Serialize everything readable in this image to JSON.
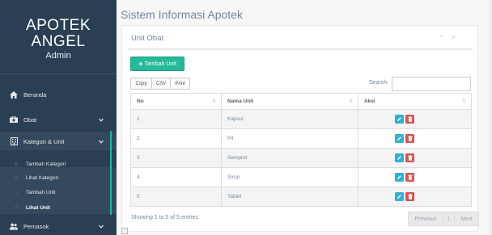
{
  "app": {
    "brand_line1": "APOTEK",
    "brand_line2": "ANGEL",
    "brand_sub": "Admin"
  },
  "sidebar": {
    "items": [
      {
        "label": "Beranda",
        "icon": "home-icon"
      },
      {
        "label": "Obat",
        "icon": "medkit-icon",
        "has_chevron": true
      },
      {
        "label": "Kategori & Unit",
        "icon": "building-icon",
        "has_chevron": true,
        "expanded": true
      },
      {
        "label": "Pemasok",
        "icon": "users-icon",
        "has_chevron": true
      }
    ],
    "sub_items": [
      {
        "label": "Tambah Kategori"
      },
      {
        "label": "Lihat Kategori"
      },
      {
        "label": "Tambah Unit"
      },
      {
        "label": "Lihat Unit",
        "current": true
      }
    ]
  },
  "page": {
    "title": "Sistem Informasi Apotek"
  },
  "panel": {
    "title": "Unit Obat",
    "tools": "^ ×",
    "add_button": "Tambah Unit",
    "export_buttons": [
      "Copy",
      "CSV",
      "Print"
    ],
    "search_label": "Search:",
    "search_value": ""
  },
  "table": {
    "headers": [
      "No",
      "Nama Unit",
      "Aksi"
    ],
    "rows": [
      {
        "no": "1",
        "name": "Kapsul"
      },
      {
        "no": "2",
        "name": "Pil"
      },
      {
        "no": "3",
        "name": "Semprot"
      },
      {
        "no": "4",
        "name": "Sirup"
      },
      {
        "no": "5",
        "name": "Tablet"
      }
    ]
  },
  "footer": {
    "info": "Showing 1 to 5 of 5 entries",
    "previous": "Previous",
    "page": "1",
    "next": "Next"
  },
  "colors": {
    "sidebar_bg": "#2a3f54",
    "accent_green": "#26b99a",
    "edit_blue": "#31b0d5",
    "delete_red": "#d9534f"
  }
}
